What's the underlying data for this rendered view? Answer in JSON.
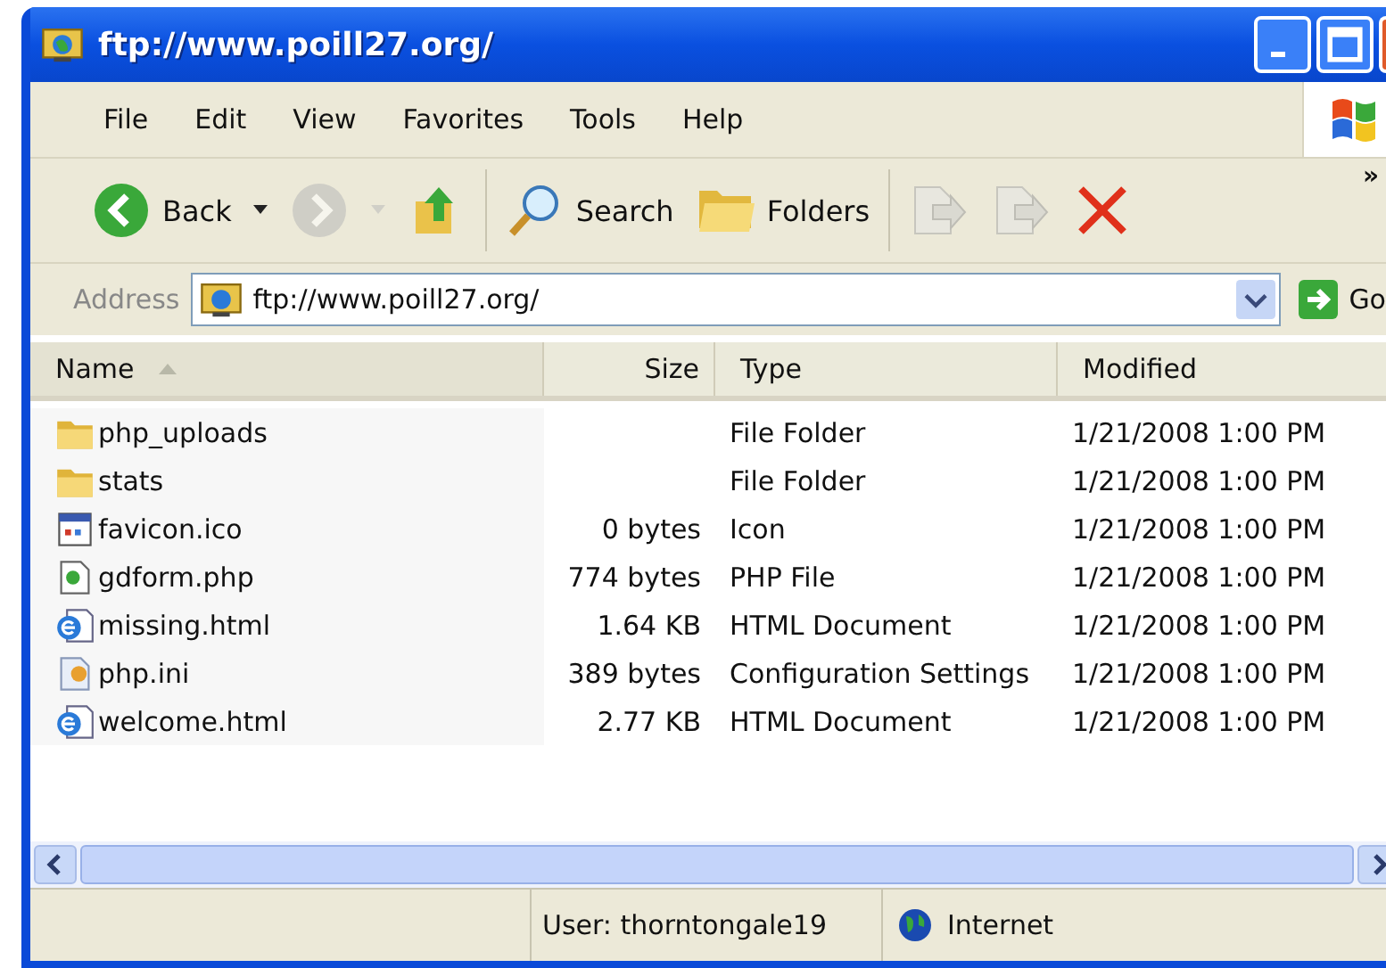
{
  "window": {
    "title": "ftp://www.poill27.org/"
  },
  "menu": [
    "File",
    "Edit",
    "View",
    "Favorites",
    "Tools",
    "Help"
  ],
  "toolbar": [
    {
      "kind": "back",
      "label": "Back",
      "disabled": false
    },
    {
      "kind": "forward",
      "disabled": true
    },
    {
      "kind": "up",
      "disabled": false
    },
    {
      "kind": "search",
      "label": "Search",
      "disabled": false
    },
    {
      "kind": "folders",
      "label": "Folders",
      "disabled": false
    },
    {
      "kind": "move",
      "disabled": true
    },
    {
      "kind": "copy",
      "disabled": true
    },
    {
      "kind": "delete",
      "disabled": false
    }
  ],
  "toolbar_more": "»",
  "address": {
    "label": "Address",
    "value": "ftp://www.poill27.org/",
    "go": "Go"
  },
  "columns": [
    {
      "label": "Name",
      "sorted": true
    },
    {
      "label": "Size",
      "sorted": false
    },
    {
      "label": "Type",
      "sorted": false
    },
    {
      "label": "Modified",
      "sorted": false
    }
  ],
  "rows": [
    {
      "kind": "folder",
      "name": "php_uploads",
      "type": "File Folder",
      "modified": "1/21/2008 1:00 PM"
    },
    {
      "kind": "folder",
      "name": "stats",
      "type": "File Folder",
      "modified": "1/21/2008 1:00 PM"
    },
    {
      "kind": "ico",
      "name": "favicon.ico",
      "size": "0 bytes",
      "type": "Icon",
      "modified": "1/21/2008 1:00 PM"
    },
    {
      "kind": "php",
      "name": "gdform.php",
      "size": "774 bytes",
      "type": "PHP File",
      "modified": "1/21/2008 1:00 PM"
    },
    {
      "kind": "html",
      "name": "missing.html",
      "size": "1.64 KB",
      "type": "HTML Document",
      "modified": "1/21/2008 1:00 PM"
    },
    {
      "kind": "config",
      "name": "php.ini",
      "size": "389 bytes",
      "type": "Configuration Settings",
      "modified": "1/21/2008 1:00 PM"
    },
    {
      "kind": "html",
      "name": "welcome.html",
      "size": "2.77 KB",
      "type": "HTML Document",
      "modified": "1/21/2008 1:00 PM"
    }
  ],
  "status_bar": {
    "user": "User: thorntongale19",
    "zone": "Internet"
  }
}
